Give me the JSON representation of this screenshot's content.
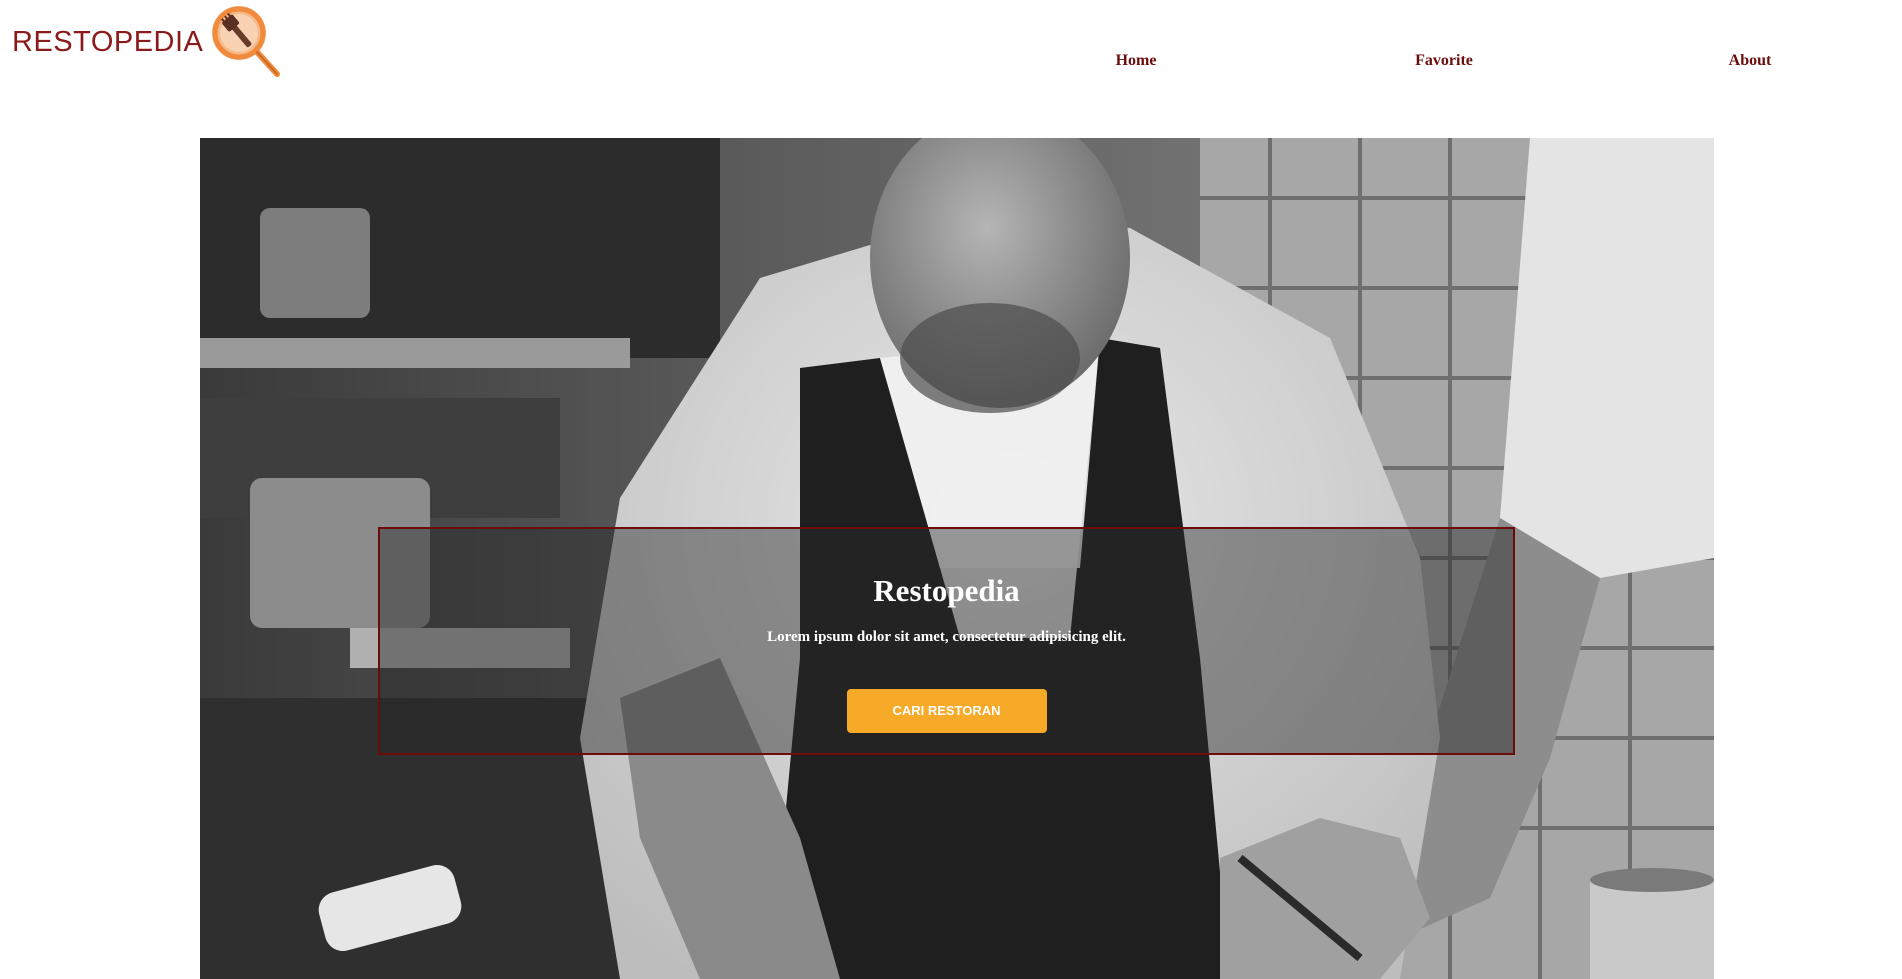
{
  "header": {
    "logo_text": "RESTOPEDIA",
    "logo_icon": "magnifier-fork-icon",
    "nav": [
      {
        "label": "Home"
      },
      {
        "label": "Favorite"
      },
      {
        "label": "About"
      }
    ]
  },
  "hero": {
    "image": "chef-cooking-photo",
    "title": "Restopedia",
    "subtitle": "Lorem ipsum dolor sit amet, consectetur adipisicing elit.",
    "cta_label": "CARI RESTORAN"
  },
  "colors": {
    "brand": "#8b1a1a",
    "nav_text": "#6b0d0d",
    "logo_accent": "#f39a4b",
    "cta_bg": "#f7a928",
    "card_border": "#6e0a0a"
  }
}
